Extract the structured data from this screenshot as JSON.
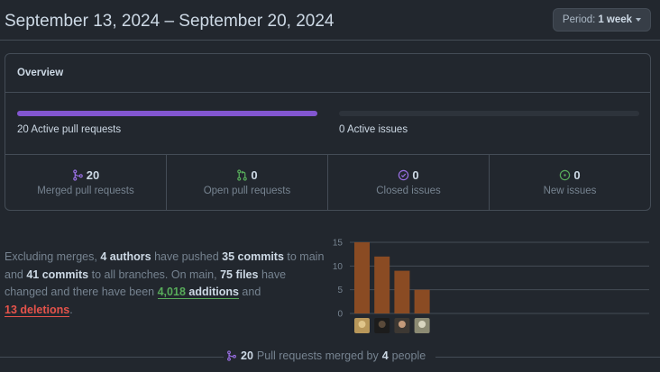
{
  "header": {
    "date_range": "September 13, 2024 – September 20, 2024",
    "period_label": "Period:",
    "period_value": "1 week"
  },
  "overview": {
    "title": "Overview",
    "pull_requests_caption_count": "20",
    "pull_requests_caption_text": "Active pull requests",
    "pull_requests_fill_fraction": 1.0,
    "issues_caption_count": "0",
    "issues_caption_text": "Active issues",
    "issues_fill_fraction": 0,
    "stats": [
      {
        "icon": "merge-icon",
        "count": "20",
        "label": "Merged pull requests",
        "color": "#986ee2"
      },
      {
        "icon": "open-pr-icon",
        "count": "0",
        "label": "Open pull requests",
        "color": "#57ab5a"
      },
      {
        "icon": "closed-issue-icon",
        "count": "0",
        "label": "Closed issues",
        "color": "#986ee2"
      },
      {
        "icon": "new-issue-icon",
        "count": "0",
        "label": "New issues",
        "color": "#57ab5a"
      }
    ]
  },
  "summary": {
    "p1": "Excluding merges,",
    "authors": "4 authors",
    "p2": "have pushed",
    "commits": "35 commits",
    "p3": "to main and",
    "all_commits": "41 commits",
    "p4": "to all branches. On main,",
    "files": "75 files",
    "p5": "have changed and there have been",
    "additions_num": "4,018",
    "additions_word": "additions",
    "p6": "and",
    "deletions": "13 deletions",
    "p7": "."
  },
  "chart_data": {
    "type": "bar",
    "categories": [
      "author-1",
      "author-2",
      "author-3",
      "author-4"
    ],
    "values": [
      15,
      12,
      9,
      5
    ],
    "ylim": [
      0,
      15
    ],
    "yticks": [
      "15",
      "10",
      "5",
      "0"
    ],
    "bar_color": "#8a4b23",
    "grid": true
  },
  "footer": {
    "count": "20",
    "text1": "Pull requests merged by",
    "people": "4",
    "text2": "people"
  }
}
